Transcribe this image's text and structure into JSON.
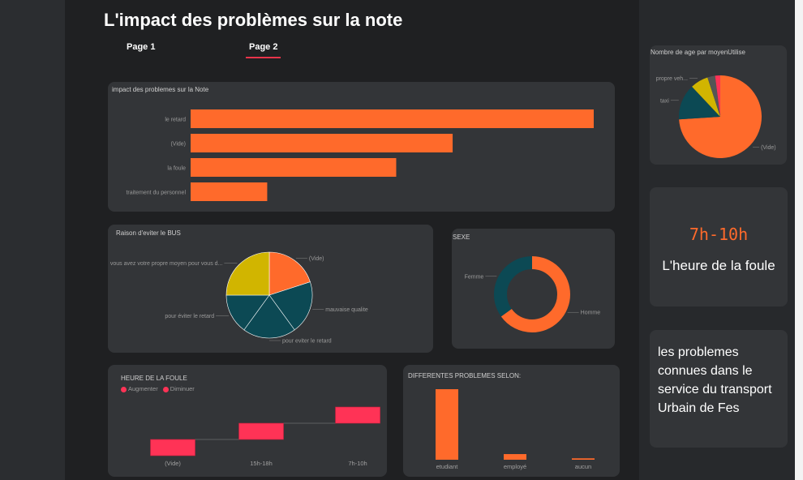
{
  "page": {
    "title": "L'impact des problèmes sur la note",
    "tabs": [
      {
        "label": "Page 1",
        "active": false
      },
      {
        "label": "Page 2",
        "active": true
      }
    ]
  },
  "colors": {
    "orange": "#ff6a2b",
    "teal": "#0c4954",
    "yellow": "#d1b500",
    "red": "#ff3356",
    "grey": "#555555"
  },
  "chart_data": [
    {
      "id": "impact",
      "type": "bar",
      "orientation": "horizontal",
      "title": "impact des problemes sur la Note",
      "categories": [
        "le retard",
        "(Vide)",
        "la foule",
        "traitement du personnel"
      ],
      "values": [
        100,
        65,
        51,
        19
      ]
    },
    {
      "id": "age",
      "type": "pie",
      "title": "Nombre de age par moyenUtilise",
      "slices": [
        {
          "label": "(Vide)",
          "value": 74,
          "color": "#ff6a2b",
          "show_label": true
        },
        {
          "label": "taxi",
          "value": 14,
          "color": "#0c4954",
          "show_label": true
        },
        {
          "label": "propre veh...",
          "value": 7,
          "color": "#d1b500",
          "show_label": true
        },
        {
          "label": "",
          "value": 3,
          "color": "#555555",
          "show_label": false
        },
        {
          "label": "",
          "value": 2,
          "color": "#ff3356",
          "show_label": false
        }
      ]
    },
    {
      "id": "bus",
      "type": "pie",
      "title": "Raison d'eviter le BUS",
      "slices": [
        {
          "label": "(Vide)",
          "value": 20,
          "color": "#ff6a2b"
        },
        {
          "label": "mauvaise qualite",
          "value": 20,
          "color": "#0c4954"
        },
        {
          "label": "pour eviter le retard",
          "value": 20,
          "color": "#0c4954"
        },
        {
          "label": "pour éviter le retard",
          "value": 15,
          "color": "#0c4954"
        },
        {
          "label": "vous avez votre propre moyen pour vous d...",
          "value": 25,
          "color": "#d1b500"
        }
      ]
    },
    {
      "id": "sexe",
      "type": "donut",
      "title": "SEXE",
      "slices": [
        {
          "label": "Homme",
          "value": 65,
          "color": "#ff6a2b"
        },
        {
          "label": "Femme",
          "value": 35,
          "color": "#0c4954"
        }
      ]
    },
    {
      "id": "foule",
      "type": "waterfall",
      "title": "HEURE DE LA FOULE",
      "legend": [
        "Augmenter",
        "Diminuer"
      ],
      "categories": [
        "(Vide)",
        "15h-18h",
        "7h-10h"
      ],
      "steps": [
        {
          "start": 0,
          "end": 1
        },
        {
          "start": 1,
          "end": 2
        },
        {
          "start": 2,
          "end": 3
        }
      ]
    },
    {
      "id": "problemes",
      "type": "bar",
      "title": "DIFFERENTES PROBLEMES SELON:",
      "categories": [
        "etudiant",
        "employé",
        "aucun"
      ],
      "values": [
        100,
        8,
        2
      ]
    }
  ],
  "cards": {
    "time_value": "7h-10h",
    "time_caption": "L'heure de  la foule",
    "info_text": "les problemes connues dans le service du transport Urbain de Fes"
  }
}
